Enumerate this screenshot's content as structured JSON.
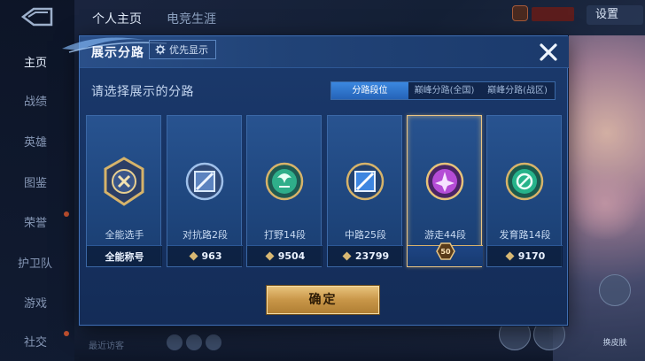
{
  "background": {
    "top_tabs": [
      "个人主页",
      "电竞生涯"
    ],
    "side_nav": [
      "主页",
      "战绩",
      "英雄",
      "图鉴",
      "荣誉",
      "护卫队",
      "游戏",
      "社交"
    ],
    "settings": "设置",
    "bottom_hint": "最近访客",
    "bottom_right_label": "换皮肤"
  },
  "modal": {
    "title": "展示分路",
    "priority_button": "优先显示",
    "prompt": "请选择展示的分路",
    "segments": [
      "分路段位",
      "巅峰分路(全国)",
      "巅峰分路(战区)"
    ],
    "active_segment": 0,
    "cards": [
      {
        "name": "全能选手",
        "stat": "全能称号",
        "emblem": "all-round",
        "color": "#d6b36a",
        "selected": false
      },
      {
        "name": "对抗路2段",
        "stat": "963",
        "emblem": "clash-lane",
        "color": "#8fb6e6",
        "selected": false
      },
      {
        "name": "打野14段",
        "stat": "9504",
        "emblem": "jungle",
        "color": "#2fae8a",
        "selected": false
      },
      {
        "name": "中路25段",
        "stat": "23799",
        "emblem": "mid-lane",
        "color": "#3e86e0",
        "selected": false
      },
      {
        "name": "游走44段",
        "stat": "50",
        "emblem": "roam",
        "color": "#b54cd6",
        "selected": true
      },
      {
        "name": "发育路14段",
        "stat": "9170",
        "emblem": "farm-lane",
        "color": "#26b38a",
        "selected": false
      }
    ],
    "confirm_button": "确定"
  }
}
